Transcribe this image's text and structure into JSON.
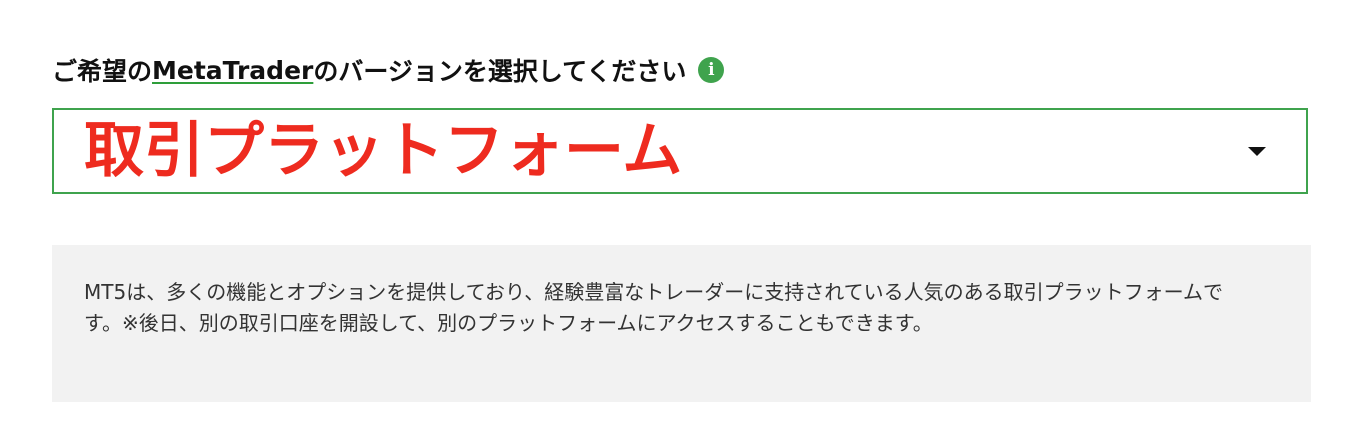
{
  "platform_select": {
    "label_prefix": "ご希望の",
    "label_link": "MetaTrader",
    "label_suffix": "のバージョンを選択してください",
    "info_icon_glyph": "i",
    "selected_value": "取引プラットフォーム",
    "accent_color": "#3fa34d",
    "value_color": "#ee2b1f"
  },
  "description": {
    "text": "MT5は、多くの機能とオプションを提供しており、経験豊富なトレーダーに支持されている人気のある取引プラットフォームです。※後日、別の取引口座を開設して、別のプラットフォームにアクセスすることもできます。"
  }
}
